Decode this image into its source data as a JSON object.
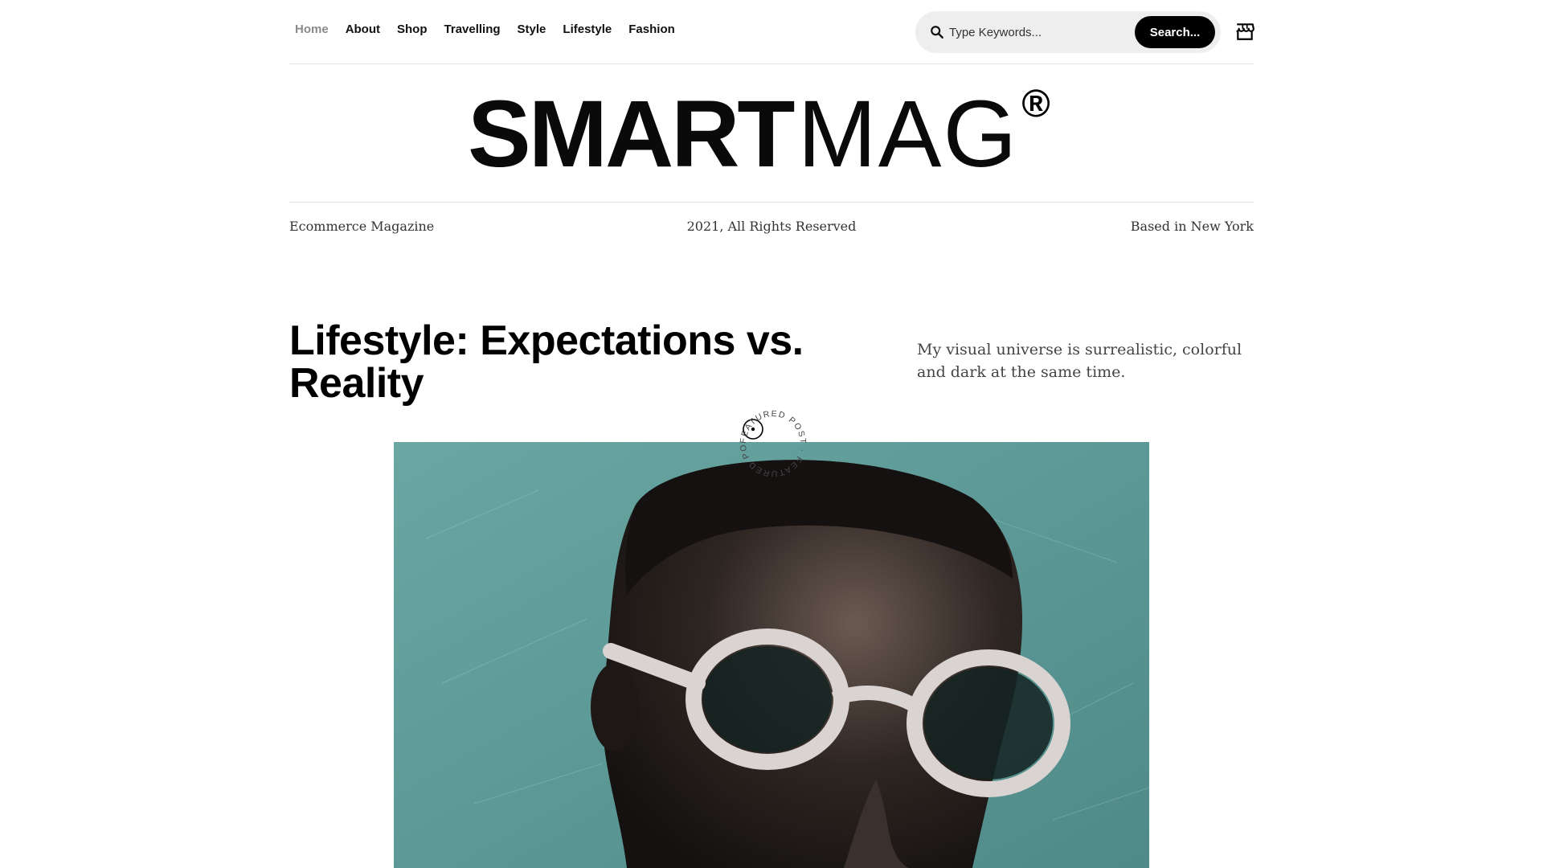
{
  "nav": {
    "items": [
      {
        "label": "Home",
        "active": true
      },
      {
        "label": "About"
      },
      {
        "label": "Shop"
      },
      {
        "label": "Travelling"
      },
      {
        "label": "Style"
      },
      {
        "label": "Lifestyle"
      },
      {
        "label": "Fashion"
      }
    ]
  },
  "search": {
    "placeholder": "Type Keywords...",
    "button_label": "Search..."
  },
  "cart": {
    "icon": "shop-icon"
  },
  "logo": {
    "bold": "SMART",
    "light": "MAG",
    "mark": "®"
  },
  "info": {
    "left": "Ecommerce Magazine",
    "center": "2021, All Rights Reserved",
    "right": "Based in New York"
  },
  "post": {
    "title": "Lifestyle: Expectations vs. Reality",
    "excerpt": "My visual universe is surrealistic, colorful and dark at the same time.",
    "badge_text": "FEATURED POST · FEATURED POST ·"
  },
  "colors": {
    "accent": "#000000",
    "muted_nav": "#8a8a8a",
    "hero_bg": "#5b9896"
  }
}
